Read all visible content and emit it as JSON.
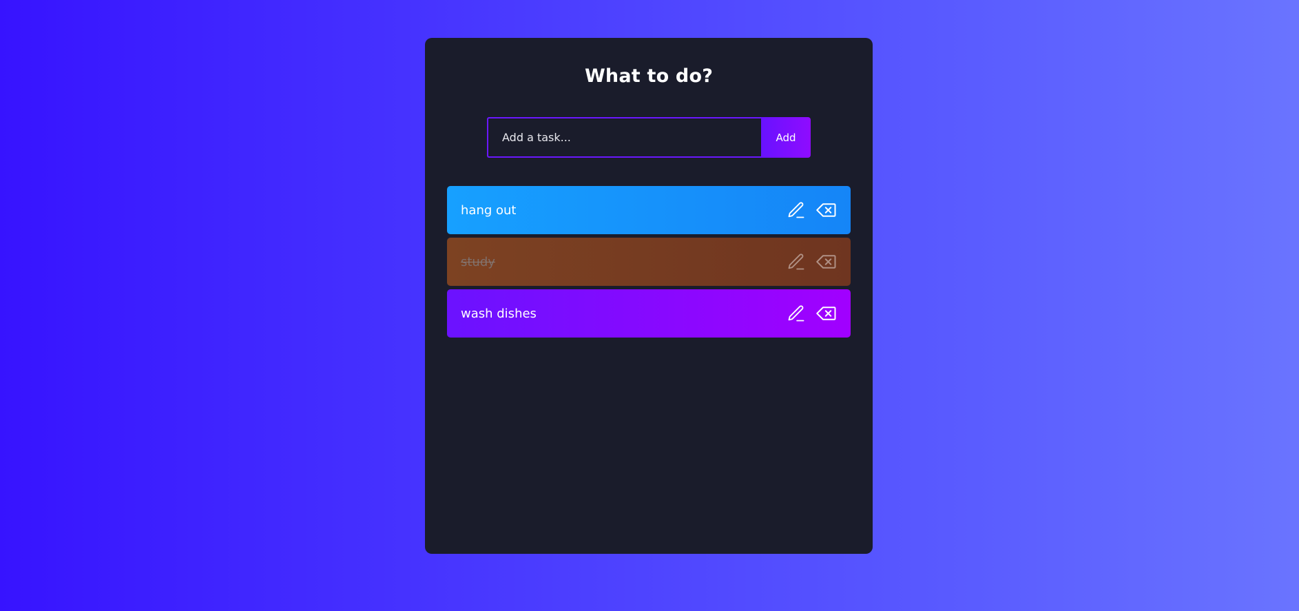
{
  "title": "What to do?",
  "form": {
    "placeholder": "Add a task...",
    "value": "",
    "add_label": "Add"
  },
  "todos": [
    {
      "text": "hang out",
      "completed": false,
      "edit_icon": "pencil-icon",
      "delete_icon": "backspace-x-icon"
    },
    {
      "text": "study",
      "completed": true,
      "edit_icon": "pencil-icon",
      "delete_icon": "backspace-x-icon"
    },
    {
      "text": "wash dishes",
      "completed": false,
      "edit_icon": "pencil-icon",
      "delete_icon": "backspace-x-icon"
    }
  ],
  "colors": {
    "background_left": "#3713ff",
    "background_right": "#6a74ff",
    "panel": "#1a1c2b",
    "todo_blue": "#17a0ff",
    "todo_brown": "#7d4222",
    "todo_purple": "#8f0cff",
    "accent": "#6b17ff"
  }
}
